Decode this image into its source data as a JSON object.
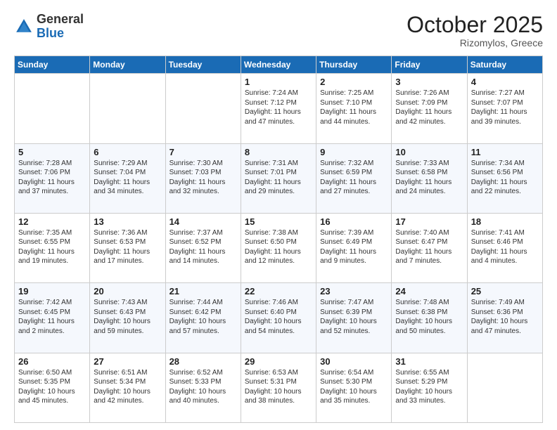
{
  "header": {
    "logo_general": "General",
    "logo_blue": "Blue",
    "month": "October 2025",
    "location": "Rizomylos, Greece"
  },
  "days_of_week": [
    "Sunday",
    "Monday",
    "Tuesday",
    "Wednesday",
    "Thursday",
    "Friday",
    "Saturday"
  ],
  "weeks": [
    [
      {
        "day": "",
        "info": ""
      },
      {
        "day": "",
        "info": ""
      },
      {
        "day": "",
        "info": ""
      },
      {
        "day": "1",
        "info": "Sunrise: 7:24 AM\nSunset: 7:12 PM\nDaylight: 11 hours and 47 minutes."
      },
      {
        "day": "2",
        "info": "Sunrise: 7:25 AM\nSunset: 7:10 PM\nDaylight: 11 hours and 44 minutes."
      },
      {
        "day": "3",
        "info": "Sunrise: 7:26 AM\nSunset: 7:09 PM\nDaylight: 11 hours and 42 minutes."
      },
      {
        "day": "4",
        "info": "Sunrise: 7:27 AM\nSunset: 7:07 PM\nDaylight: 11 hours and 39 minutes."
      }
    ],
    [
      {
        "day": "5",
        "info": "Sunrise: 7:28 AM\nSunset: 7:06 PM\nDaylight: 11 hours and 37 minutes."
      },
      {
        "day": "6",
        "info": "Sunrise: 7:29 AM\nSunset: 7:04 PM\nDaylight: 11 hours and 34 minutes."
      },
      {
        "day": "7",
        "info": "Sunrise: 7:30 AM\nSunset: 7:03 PM\nDaylight: 11 hours and 32 minutes."
      },
      {
        "day": "8",
        "info": "Sunrise: 7:31 AM\nSunset: 7:01 PM\nDaylight: 11 hours and 29 minutes."
      },
      {
        "day": "9",
        "info": "Sunrise: 7:32 AM\nSunset: 6:59 PM\nDaylight: 11 hours and 27 minutes."
      },
      {
        "day": "10",
        "info": "Sunrise: 7:33 AM\nSunset: 6:58 PM\nDaylight: 11 hours and 24 minutes."
      },
      {
        "day": "11",
        "info": "Sunrise: 7:34 AM\nSunset: 6:56 PM\nDaylight: 11 hours and 22 minutes."
      }
    ],
    [
      {
        "day": "12",
        "info": "Sunrise: 7:35 AM\nSunset: 6:55 PM\nDaylight: 11 hours and 19 minutes."
      },
      {
        "day": "13",
        "info": "Sunrise: 7:36 AM\nSunset: 6:53 PM\nDaylight: 11 hours and 17 minutes."
      },
      {
        "day": "14",
        "info": "Sunrise: 7:37 AM\nSunset: 6:52 PM\nDaylight: 11 hours and 14 minutes."
      },
      {
        "day": "15",
        "info": "Sunrise: 7:38 AM\nSunset: 6:50 PM\nDaylight: 11 hours and 12 minutes."
      },
      {
        "day": "16",
        "info": "Sunrise: 7:39 AM\nSunset: 6:49 PM\nDaylight: 11 hours and 9 minutes."
      },
      {
        "day": "17",
        "info": "Sunrise: 7:40 AM\nSunset: 6:47 PM\nDaylight: 11 hours and 7 minutes."
      },
      {
        "day": "18",
        "info": "Sunrise: 7:41 AM\nSunset: 6:46 PM\nDaylight: 11 hours and 4 minutes."
      }
    ],
    [
      {
        "day": "19",
        "info": "Sunrise: 7:42 AM\nSunset: 6:45 PM\nDaylight: 11 hours and 2 minutes."
      },
      {
        "day": "20",
        "info": "Sunrise: 7:43 AM\nSunset: 6:43 PM\nDaylight: 10 hours and 59 minutes."
      },
      {
        "day": "21",
        "info": "Sunrise: 7:44 AM\nSunset: 6:42 PM\nDaylight: 10 hours and 57 minutes."
      },
      {
        "day": "22",
        "info": "Sunrise: 7:46 AM\nSunset: 6:40 PM\nDaylight: 10 hours and 54 minutes."
      },
      {
        "day": "23",
        "info": "Sunrise: 7:47 AM\nSunset: 6:39 PM\nDaylight: 10 hours and 52 minutes."
      },
      {
        "day": "24",
        "info": "Sunrise: 7:48 AM\nSunset: 6:38 PM\nDaylight: 10 hours and 50 minutes."
      },
      {
        "day": "25",
        "info": "Sunrise: 7:49 AM\nSunset: 6:36 PM\nDaylight: 10 hours and 47 minutes."
      }
    ],
    [
      {
        "day": "26",
        "info": "Sunrise: 6:50 AM\nSunset: 5:35 PM\nDaylight: 10 hours and 45 minutes."
      },
      {
        "day": "27",
        "info": "Sunrise: 6:51 AM\nSunset: 5:34 PM\nDaylight: 10 hours and 42 minutes."
      },
      {
        "day": "28",
        "info": "Sunrise: 6:52 AM\nSunset: 5:33 PM\nDaylight: 10 hours and 40 minutes."
      },
      {
        "day": "29",
        "info": "Sunrise: 6:53 AM\nSunset: 5:31 PM\nDaylight: 10 hours and 38 minutes."
      },
      {
        "day": "30",
        "info": "Sunrise: 6:54 AM\nSunset: 5:30 PM\nDaylight: 10 hours and 35 minutes."
      },
      {
        "day": "31",
        "info": "Sunrise: 6:55 AM\nSunset: 5:29 PM\nDaylight: 10 hours and 33 minutes."
      },
      {
        "day": "",
        "info": ""
      }
    ]
  ]
}
